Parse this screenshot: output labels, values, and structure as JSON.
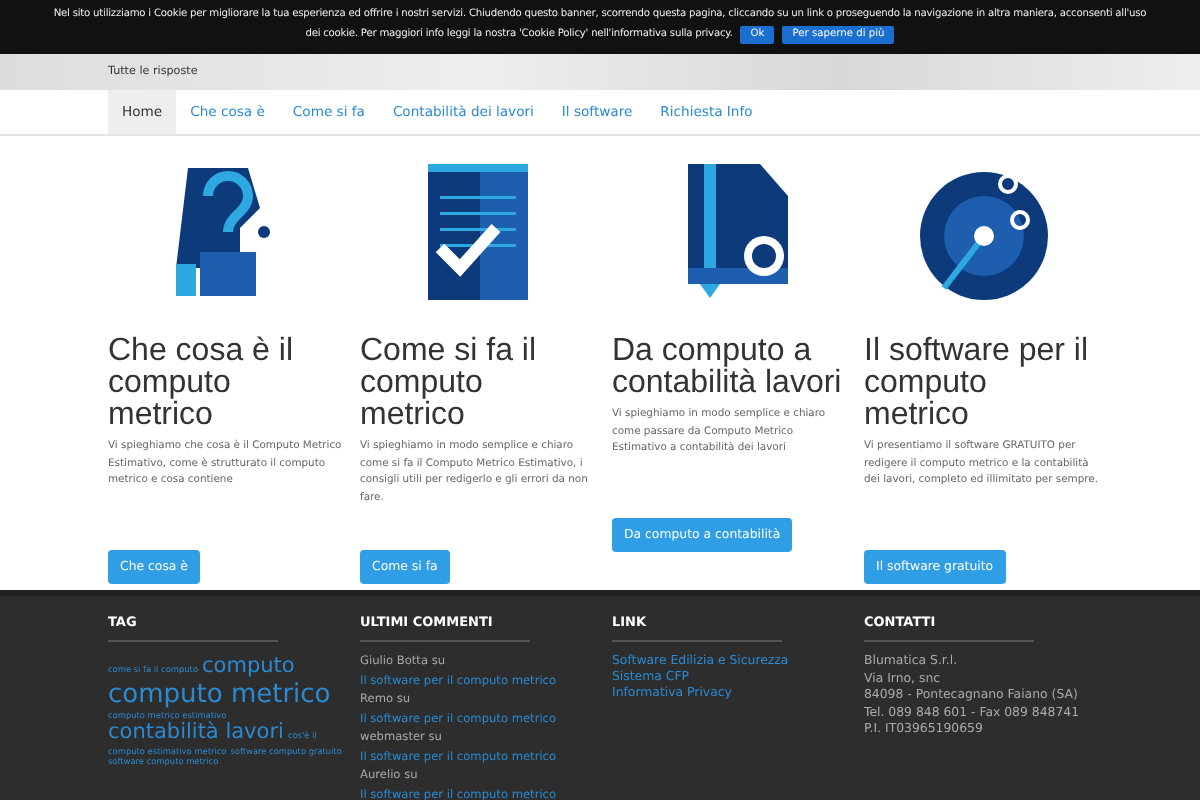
{
  "cookie_banner": {
    "lines": [
      "Nel sito utilizziamo i Cookie per migliorare la tua esperienza ed offrire i nostri servizi. Chiudendo questo banner, scorrendo questa pagina, cliccando su un link o proseguendo la navigazione in altra maniera, acconsenti all'uso",
      "dei cookie. Per maggiori info leggi la nostra 'Cookie Policy' nell'informativa sulla privacy."
    ],
    "buttons": [
      "Ok",
      "Per saperne di più"
    ]
  },
  "header": {
    "tagline": "Tutte le risposte"
  },
  "nav": [
    {
      "label": "Home",
      "selected": true
    },
    {
      "label": "Che cosa è",
      "selected": false
    },
    {
      "label": "Come si fa",
      "selected": false
    },
    {
      "label": "Contabilità dei lavori",
      "selected": false
    },
    {
      "label": "Il software",
      "selected": false
    },
    {
      "label": "Richiesta Info",
      "selected": false
    }
  ],
  "cards": [
    {
      "kind": "question",
      "title": "Che cosa è il computo metrico",
      "text": "Vi spieghiamo che cosa è il Computo Metrico Estimativo, come è strutturato il computo metrico e cosa contiene",
      "button": "Che cosa è"
    },
    {
      "kind": "checklist",
      "title": "Come si fa il computo metrico",
      "text": "Vi spieghiamo in modo semplice e chiaro come si fa il Computo Metrico Estimativo, i consigli utili per redigerlo e gli errori da non fare.",
      "button": "Come si fa"
    },
    {
      "kind": "money",
      "title": "Da computo a contabilità lavori",
      "text": "Vi spieghiamo in modo semplice e chiaro come passare da Computo Metrico Estimativo a contabilità dei lavori",
      "button": "Da computo a contabilità"
    },
    {
      "kind": "disc",
      "title": "Il software per il computo metrico",
      "text": "Vi presentiamo il software GRATUITO per redigere il computo metrico e la contabilità dei lavori, completo ed illimitato per sempre.",
      "button": "Il software gratuito"
    }
  ],
  "footer": {
    "tags": {
      "heading": "TAG",
      "items": [
        {
          "label": "come si fa il computo",
          "kind": "small"
        },
        {
          "label": "computo",
          "kind": "large"
        },
        {
          "label": "computo metrico",
          "kind": "xlarge"
        },
        {
          "label": "computo metrico estimativo",
          "kind": "small"
        },
        {
          "label": "contabilità lavori",
          "kind": "large"
        },
        {
          "label": "cos'è il",
          "kind": "small"
        },
        {
          "label": "computo estimativo metrico",
          "kind": "small"
        },
        {
          "label": "software computo gratuito",
          "kind": "small"
        },
        {
          "label": "software computo metrico",
          "kind": "small"
        }
      ]
    },
    "comments": {
      "heading": "ULTIMI COMMENTI",
      "items": [
        {
          "author": "Giulio Botta",
          "sep": "su",
          "link": "Il software per il computo metrico"
        },
        {
          "author": "Remo",
          "sep": "su",
          "link": "Il software per il computo metrico"
        },
        {
          "author": "webmaster",
          "sep": "su",
          "link": "Il software per il computo metrico"
        },
        {
          "author": "Aurelio",
          "sep": "su",
          "link": "Il software per il computo metrico"
        }
      ]
    },
    "links": {
      "heading": "LINK",
      "items": [
        "Software Edilizia e Sicurezza",
        "Sistema CFP",
        "Informativa Privacy"
      ]
    },
    "contacts": {
      "heading": "CONTATTI",
      "lines": [
        "Blumatica S.r.l.",
        "Via Irno, snc",
        "84098 - Pontecagnano Faiano (SA)",
        "Tel. 089 848 601 - Fax 089 848741",
        "P.I. IT03965190659"
      ]
    }
  }
}
